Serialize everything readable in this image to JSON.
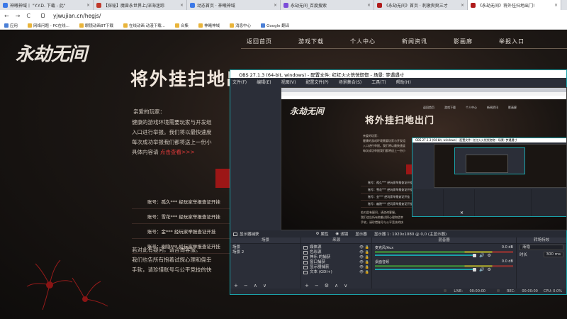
{
  "browser": {
    "tabs": [
      {
        "title": "神曦神域丨 \"Y.Y.D. 下载 - 此\"",
        "icon_color": "#3b78e7",
        "active": false
      },
      {
        "title": "【探秘】魔兽永世界上/深海迷踪",
        "icon_color": "#c0392b",
        "active": false
      },
      {
        "title": "动态首页 · 神曦神域",
        "icon_color": "#3b78e7",
        "active": false
      },
      {
        "title": "永劫无间_百度搜索",
        "icon_color": "#7b4dd8",
        "active": false
      },
      {
        "title": "《永劫无间》首页 · 刺激爽爽三才",
        "icon_color": "#b01c1c",
        "active": false
      },
      {
        "title": "《永劫无间》将外挂扫地出门!",
        "icon_color": "#b01c1c",
        "active": true
      }
    ],
    "tab_close": "×",
    "nav_back": "←",
    "nav_forward": "→",
    "nav_reload": "C",
    "url": "yjwujian.cn/hegjs/",
    "bookmarks": [
      "应用",
      "网络问题 - PC在线...",
      "眼镜动画BT下载",
      "在线动画 动漫下载...",
      "合集",
      "神曦神域",
      "消息中心",
      "Google 翻译"
    ]
  },
  "site": {
    "logo": "永劫无间",
    "nav": [
      "返回首页",
      "游戏下载",
      "个人中心",
      "新闻资讯",
      "影画廊",
      "举报入口"
    ],
    "title": "将外挂扫地出门",
    "greeting": "亲爱的玩家：",
    "paragraph": [
      "健康的游戏环境需要玩家与开发组",
      "入口进行举报。我们将以最快速度",
      "每次成功举报我们都将送上一份小",
      "具体内容请"
    ],
    "link": "点击查看>>>",
    "reports": [
      "账号：孤久*** 经玩家举报查证开挂",
      "账号：雪花*** 经玩家举报查证开挂",
      "账号：金*** 经玩家举报查证开挂",
      "账号：幽隐*** 经玩家举报查证开挂"
    ],
    "bottom": [
      "若对此有疑问，请咨询客服。",
      "我们也告所有抱着试探心理和侥幸",
      "手软，请珍惜账号与公平竞技的快"
    ]
  },
  "obs": {
    "title": "OBS 27.1.3 (64-bit, windows) - 配置文件: 红红火火恍恍惚惚 - 场景: 梦遇遇寸",
    "menu": [
      "文件(F)",
      "编辑(E)",
      "视图(V)",
      "配置文件(P)",
      "场景集合(S)",
      "工具(T)",
      "帮助(H)"
    ],
    "preview": {
      "nav": [
        "返回首页",
        "游戏下载",
        "个人中心",
        "新闻资讯",
        "影画廊"
      ]
    },
    "cursor": "✕",
    "source_bar": {
      "current": "显示器捕获",
      "properties": "属性",
      "filters": "滤镜",
      "display_label": "显示器",
      "display_value": "显示器 1: 1920x1080 @ 0,0 (主显示器)"
    },
    "scenes": {
      "header": "场景",
      "items": [
        "场景",
        "场景 2"
      ]
    },
    "sources": {
      "header": "来源",
      "items": [
        "媒体源",
        "色彩源",
        "神乐 的捕获",
        "窗口捕获",
        "显示器捕获",
        "文本 (GDI+)"
      ]
    },
    "mixer": {
      "header": "混音器",
      "channels": [
        {
          "name": "麦克风/Aux",
          "db": "0.0 dB",
          "level": 0.93
        },
        {
          "name": "桌面音频",
          "db": "0.0 dB",
          "level": 0.93
        }
      ]
    },
    "transitions": {
      "header": "转场特效",
      "type": "渐隐",
      "duration_label": "时长",
      "duration": "300 ms"
    },
    "dock_footer": {
      "add": "+",
      "remove": "−",
      "up": "∧",
      "down": "∨",
      "settings": "⚙"
    },
    "source_icons": {
      "eye": "👁",
      "lock": "🔒"
    },
    "speaker_icon": "🔊",
    "status": {
      "live_label": "LIVE:",
      "live_time": "00:00:00",
      "rec_label": "REC:",
      "rec_time": "00:00:00",
      "cpu": "CPU: 0.0%"
    }
  },
  "colors": {
    "obs_accent": "#1aa1a8",
    "site_red": "#9c1616",
    "link_red": "#e03a3a"
  }
}
